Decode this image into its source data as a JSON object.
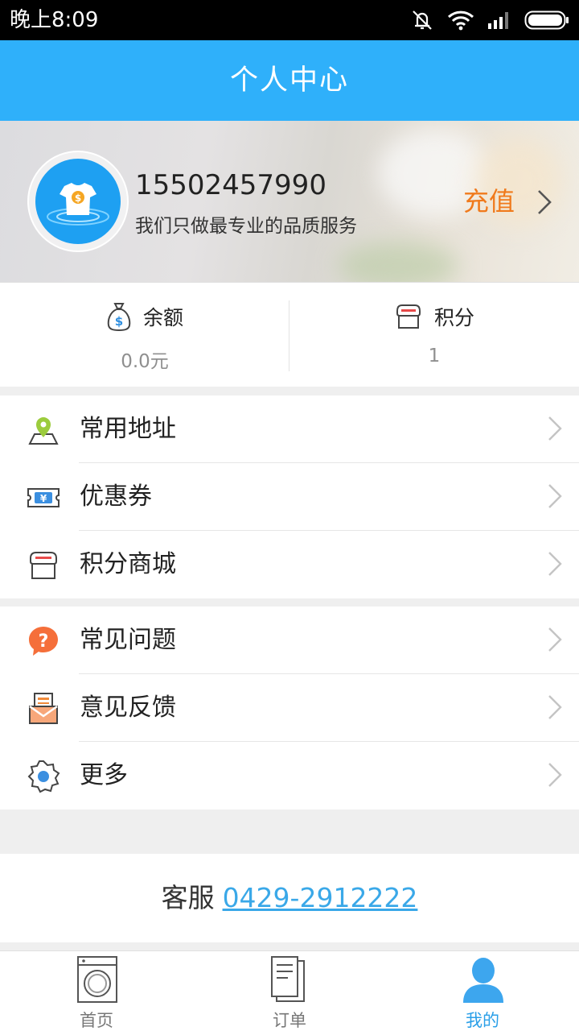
{
  "status_bar": {
    "time": "晚上8:09",
    "icons": [
      "mute-icon",
      "wifi-icon",
      "signal-icon",
      "battery-icon"
    ]
  },
  "header": {
    "title": "个人中心"
  },
  "profile": {
    "avatar_icon": "tshirt-logo-icon",
    "phone": "15502457990",
    "slogan": "我们只做最专业的品质服务",
    "recharge_label": "充值"
  },
  "stats": {
    "balance": {
      "label": "余额",
      "value": "0.0元",
      "icon": "money-bag-icon"
    },
    "points": {
      "label": "积分",
      "value": "1",
      "icon": "shop-icon"
    }
  },
  "menu_group_1": [
    {
      "label": "常用地址",
      "icon": "location-icon"
    },
    {
      "label": "优惠券",
      "icon": "coupon-icon"
    },
    {
      "label": "积分商城",
      "icon": "points-mall-icon"
    }
  ],
  "menu_group_2": [
    {
      "label": "常见问题",
      "icon": "question-icon"
    },
    {
      "label": "意见反馈",
      "icon": "feedback-icon"
    },
    {
      "label": "更多",
      "icon": "gear-icon"
    }
  ],
  "support": {
    "label": "客服",
    "phone": "0429-2912222"
  },
  "bottom_nav": [
    {
      "label": "首页",
      "icon": "washing-machine-icon",
      "active": false
    },
    {
      "label": "订单",
      "icon": "order-document-icon",
      "active": false
    },
    {
      "label": "我的",
      "icon": "user-icon",
      "active": true
    }
  ],
  "colors": {
    "header": "#2fb0fa",
    "accent_orange": "#f07a1c",
    "link_blue": "#3aa8e8",
    "active_tab": "#2a9fe8"
  }
}
